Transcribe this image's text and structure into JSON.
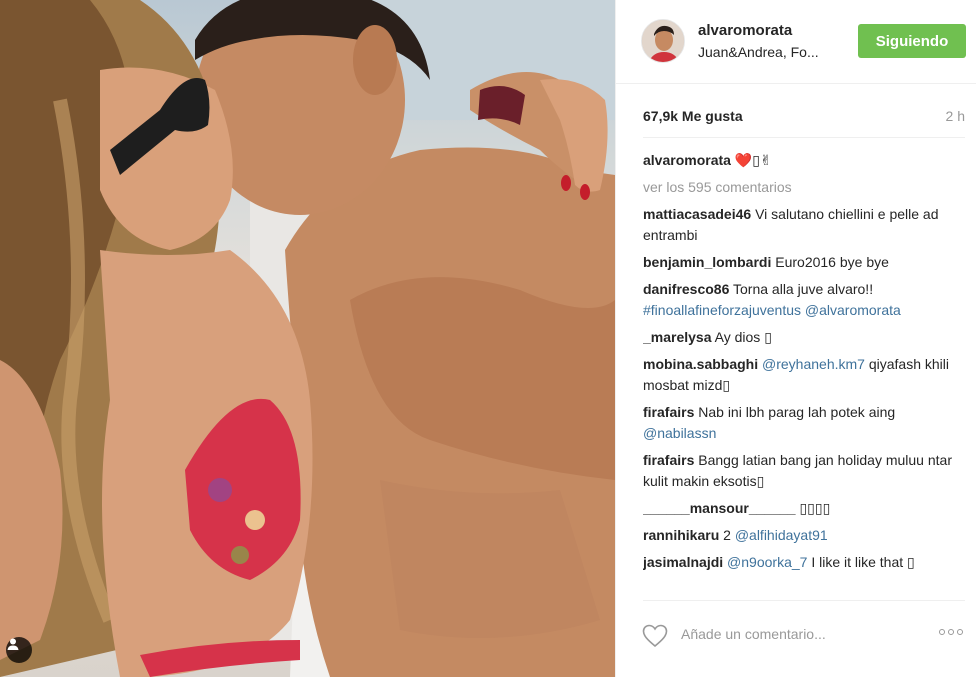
{
  "photo": {
    "alt_icon": "person-tag-icon"
  },
  "header": {
    "username": "alvaromorata",
    "location": "Juan&Andrea, Fo...",
    "follow_label": "Siguiendo"
  },
  "stats": {
    "likes": "67,9k Me gusta",
    "time": "2 h"
  },
  "caption": {
    "user": "alvaromorata",
    "text": "❤️▯✌"
  },
  "view_comments": "ver los 595 comentarios",
  "comments": [
    {
      "user": "mattiacasadei46",
      "parts": [
        {
          "t": "text",
          "v": "Vi salutano chiellini e pelle ad entrambi"
        }
      ]
    },
    {
      "user": "benjamin_lombardi",
      "parts": [
        {
          "t": "text",
          "v": "Euro2016 bye bye"
        }
      ]
    },
    {
      "user": "danifresco86",
      "parts": [
        {
          "t": "text",
          "v": "Torna alla juve alvaro!! "
        },
        {
          "t": "mention",
          "v": "#finoallafineforzajuventus"
        },
        {
          "t": "text",
          "v": " "
        },
        {
          "t": "mention",
          "v": "@alvaromorata"
        }
      ]
    },
    {
      "user": "_marelysa",
      "parts": [
        {
          "t": "text",
          "v": "Ay dios ▯"
        }
      ]
    },
    {
      "user": "mobina.sabbaghi",
      "parts": [
        {
          "t": "mention",
          "v": "@reyhaneh.km7"
        },
        {
          "t": "text",
          "v": " qiyafash khili mosbat mizd▯"
        }
      ]
    },
    {
      "user": "firafairs",
      "parts": [
        {
          "t": "text",
          "v": "Nab ini lbh parag lah potek aing "
        },
        {
          "t": "mention",
          "v": "@nabilassn"
        }
      ]
    },
    {
      "user": "firafairs",
      "parts": [
        {
          "t": "text",
          "v": "Bangg latian bang jan holiday muluu ntar kulit makin eksotis▯"
        }
      ]
    },
    {
      "user": "______mansour______",
      "parts": [
        {
          "t": "text",
          "v": "▯▯▯▯"
        }
      ]
    },
    {
      "user": "rannihikaru",
      "parts": [
        {
          "t": "text",
          "v": "2 "
        },
        {
          "t": "mention",
          "v": "@alfihidayat91"
        }
      ]
    },
    {
      "user": "jasimalnajdi",
      "parts": [
        {
          "t": "mention",
          "v": "@n9oorka_7"
        },
        {
          "t": "text",
          "v": " I like it like that ▯"
        }
      ]
    }
  ],
  "footer": {
    "comment_placeholder": "Añade un comentario..."
  },
  "colors": {
    "follow_green": "#70c050",
    "mention_blue": "#3f729b",
    "muted_gray": "#999999"
  }
}
